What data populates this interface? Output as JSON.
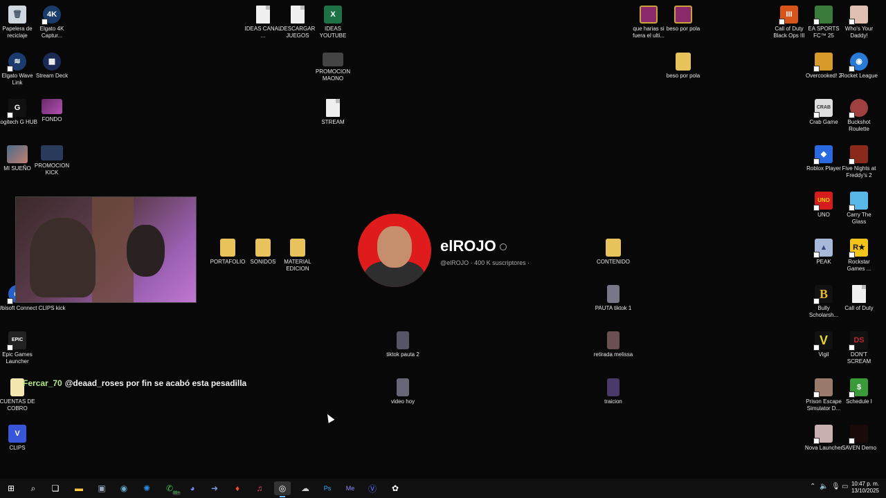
{
  "desktop": {
    "col1": [
      {
        "label": "Papelera de reciclaje",
        "icon": "recycle-bin-icon",
        "glyph": "🗑"
      },
      {
        "label": "Elgato 4K Captur...",
        "icon": "elgato-4k-icon",
        "glyph": "4K"
      },
      {
        "label": "Elgato Wave Link",
        "icon": "wave-link-icon",
        "glyph": "≋"
      },
      {
        "label": "Stream Deck",
        "icon": "stream-deck-icon",
        "glyph": "▦"
      },
      {
        "label": "Logitech G HUB",
        "icon": "logitech-icon",
        "glyph": "G"
      },
      {
        "label": "FONDO",
        "icon": "image-icon",
        "glyph": ""
      },
      {
        "label": "MI SUEÑO",
        "icon": "image-icon",
        "glyph": ""
      },
      {
        "label": "PROMOCION KICK",
        "icon": "video-icon",
        "glyph": ""
      },
      {
        "label": "Ubisoft Connect",
        "icon": "ubisoft-icon",
        "glyph": "◎"
      },
      {
        "label": "CLIPS kick",
        "icon": "folder-icon",
        "glyph": ""
      },
      {
        "label": "Epic Games Launcher",
        "icon": "epic-games-icon",
        "glyph": "EPIC"
      },
      {
        "label": "CUENTAS DE COBRO",
        "icon": "pdf-icon",
        "glyph": ""
      },
      {
        "label": "CLIPS",
        "icon": "clips-icon",
        "glyph": "V"
      }
    ],
    "center": [
      {
        "label": "IDEAS CANAL ...",
        "icon": "text-file-icon"
      },
      {
        "label": "DESCARGAR JUEGOS",
        "icon": "text-file-icon"
      },
      {
        "label": "IDEAS YOUTUBE",
        "icon": "excel-file-icon"
      },
      {
        "label": "PROMOCION MAONO",
        "icon": "image-icon"
      },
      {
        "label": "STREAM",
        "icon": "text-file-icon"
      },
      {
        "label": "PORTAFOLIO",
        "icon": "folder-icon"
      },
      {
        "label": "SONIDOS",
        "icon": "folder-icon"
      },
      {
        "label": "MATERIAL EDICION",
        "icon": "folder-icon"
      },
      {
        "label": "tiktok pauta 2",
        "icon": "video-icon"
      },
      {
        "label": "video hoy",
        "icon": "video-icon"
      }
    ],
    "right_mid": [
      {
        "label": "que harias si fuera el ulti...",
        "icon": "winrar-icon"
      },
      {
        "label": "beso por pola",
        "icon": "winrar-icon"
      },
      {
        "label": "beso por pola",
        "icon": "folder-icon"
      },
      {
        "label": "CONTENIDO",
        "icon": "folder-icon"
      },
      {
        "label": "PAUTA tiktok 1",
        "icon": "video-icon"
      },
      {
        "label": "retirada melissa",
        "icon": "video-icon"
      },
      {
        "label": "traicion",
        "icon": "video-icon"
      }
    ],
    "right_col1": [
      {
        "label": "Call of Duty Black Ops III",
        "icon": "cod-bo3-icon",
        "glyph": "III"
      },
      {
        "label": "Overcooked! 2",
        "icon": "overcooked-icon",
        "glyph": ""
      },
      {
        "label": "Crab Game",
        "icon": "crab-game-icon",
        "glyph": "CRAB"
      },
      {
        "label": "Roblox Player",
        "icon": "roblox-icon",
        "glyph": "◆"
      },
      {
        "label": "UNO",
        "icon": "uno-icon",
        "glyph": "UNO"
      },
      {
        "label": "PEAK",
        "icon": "peak-icon",
        "glyph": "▲"
      },
      {
        "label": "Bully Scholarsh...",
        "icon": "bully-icon",
        "glyph": "B"
      },
      {
        "label": "Vigil",
        "icon": "vigil-icon",
        "glyph": "V"
      },
      {
        "label": "Prison Escape Simulator D...",
        "icon": "prison-escape-icon",
        "glyph": ""
      },
      {
        "label": "Nova Launcher",
        "icon": "nova-launcher-icon",
        "glyph": ""
      }
    ],
    "right_col2": [
      {
        "label": "EA SPORTS FC™ 25",
        "icon": "ea-fc-icon",
        "glyph": ""
      },
      {
        "label": "Who's Your Daddy!",
        "icon": "whos-your-daddy-icon",
        "glyph": ""
      },
      {
        "label": "Rocket League",
        "icon": "rocket-league-icon",
        "glyph": "◉"
      },
      {
        "label": "Buckshot Roulette",
        "icon": "buckshot-icon",
        "glyph": ""
      },
      {
        "label": "Five Nights at Freddy's 2",
        "icon": "fnaf-icon",
        "glyph": ""
      },
      {
        "label": "Carry The Glass",
        "icon": "carry-glass-icon",
        "glyph": ""
      },
      {
        "label": "Rockstar Games ...",
        "icon": "rockstar-icon",
        "glyph": "R★"
      },
      {
        "label": "Call of Duty",
        "icon": "text-file-icon",
        "glyph": ""
      },
      {
        "label": "DON'T SCREAM",
        "icon": "dont-scream-icon",
        "glyph": "DS"
      },
      {
        "label": "Schedule I",
        "icon": "schedule-icon",
        "glyph": "$"
      },
      {
        "label": "SAVEN Demo",
        "icon": "saven-icon",
        "glyph": ""
      }
    ]
  },
  "overlay": {
    "chat_user": "Fercar_70",
    "chat_message": "@deaad_roses por fin se acabó esta pesadilla",
    "channel_name": "elROJO",
    "channel_meta": "@elROJO · 400 K suscriptores ·"
  },
  "taskbar": {
    "apps": [
      "windows-start-icon",
      "search-icon",
      "task-view-icon",
      "file-explorer-icon",
      "app-icon",
      "steam-icon",
      "battlenet-icon",
      "whatsapp-icon",
      "discord-icon",
      "arrow-app-icon",
      "brave-icon",
      "music-icon",
      "obs-icon",
      "app-icon",
      "photoshop-icon",
      "media-encoder-icon",
      "clips-icon",
      "chatgpt-icon"
    ],
    "badge": "99+",
    "time": "10:47 p. m.",
    "date": "13/10/2025"
  },
  "colors": {
    "background": "#080808",
    "avatar_red": "#e01b1b",
    "chat_user": "#b6e88a"
  }
}
